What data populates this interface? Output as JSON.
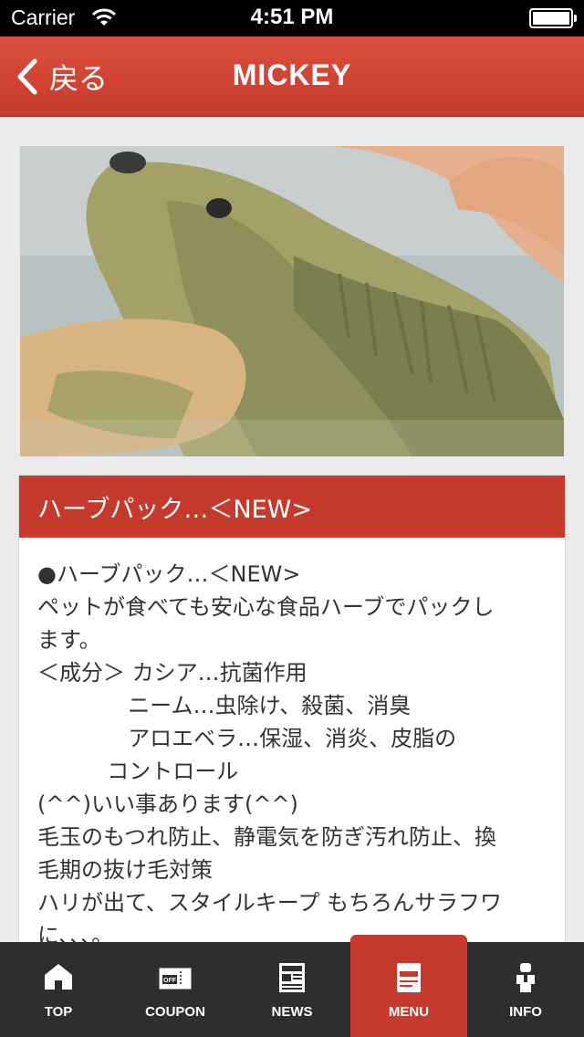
{
  "status_bar": {
    "carrier": "Carrier",
    "time": "4:51 PM"
  },
  "nav": {
    "back_label": "戻る",
    "title": "MICKEY"
  },
  "card": {
    "header": "ハーブパック…＜NEW>",
    "lines": [
      "●ハーブパック…＜NEW>",
      "ペットが食べても安心な食品ハーブでパックし",
      "ます。",
      "＜成分＞ カシア…抗菌作用",
      "             ニーム…虫除け、殺菌、消臭",
      "             アロエベラ…保湿、消炎、皮脂の",
      "          コントロール",
      "(^^)いい事あります(^^)",
      "毛玉のもつれ防止、静電気を防ぎ汚れ防止、換",
      "毛期の抜け毛対策",
      "ハリが出て、スタイルキープ もちろんサラフワ",
      "に、、、。"
    ]
  },
  "tabs": [
    {
      "label": "TOP",
      "icon": "home-icon"
    },
    {
      "label": "COUPON",
      "icon": "coupon-icon"
    },
    {
      "label": "NEWS",
      "icon": "newspaper-icon"
    },
    {
      "label": "MENU",
      "icon": "menu-book-icon",
      "active": true
    },
    {
      "label": "INFO",
      "icon": "info-person-icon"
    }
  ],
  "colors": {
    "accent": "#c63a2d",
    "tab_bar": "#2e2e2e"
  }
}
